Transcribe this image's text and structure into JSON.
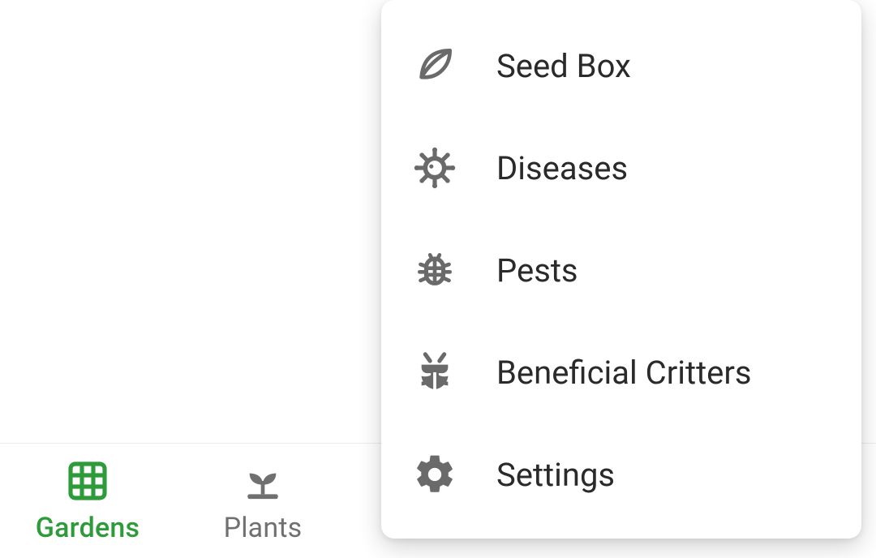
{
  "tabbar": {
    "items": [
      {
        "id": "gardens",
        "label": "Gardens",
        "active": true
      },
      {
        "id": "plants",
        "label": "Plants",
        "active": false
      },
      {
        "id": "hidden-1",
        "label": "",
        "active": false
      },
      {
        "id": "hidden-2",
        "label": "",
        "active": false
      },
      {
        "id": "hidden-3",
        "label": "",
        "active": false
      }
    ]
  },
  "menu": {
    "items": [
      {
        "id": "seed-box",
        "label": "Seed Box"
      },
      {
        "id": "diseases",
        "label": "Diseases"
      },
      {
        "id": "pests",
        "label": "Pests"
      },
      {
        "id": "beneficial-critters",
        "label": "Beneficial Critters"
      },
      {
        "id": "settings",
        "label": "Settings"
      }
    ]
  },
  "colors": {
    "active": "#2e9b3a",
    "inactive": "#707070",
    "menu_text": "#2a2a2a",
    "menu_icon": "#6a6a6a"
  }
}
